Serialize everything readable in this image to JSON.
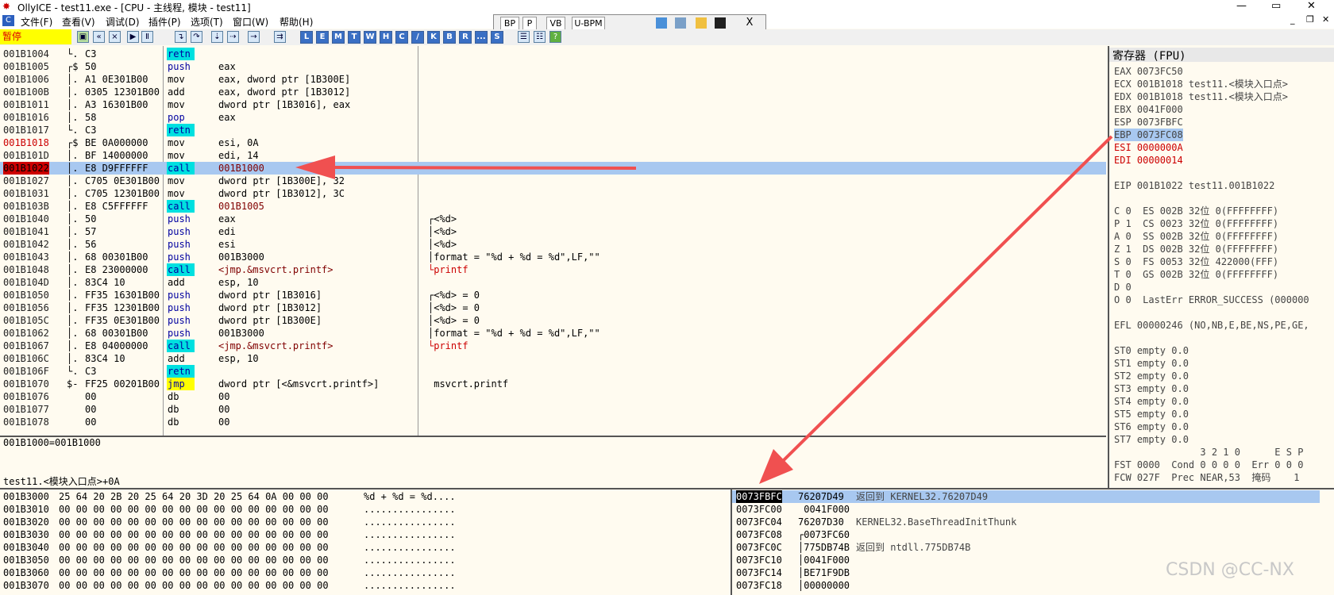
{
  "title_bar": {
    "title": "OllyICE - test11.exe - [CPU - 主线程, 模块 - test11]"
  },
  "menu": [
    "文件(F)",
    "查看(V)",
    "调试(D)",
    "插件(P)",
    "选项(T)",
    "窗口(W)",
    "帮助(H)"
  ],
  "float_toolbar": {
    "buttons": [
      "BP",
      "P",
      "VB",
      "U-BPM"
    ],
    "close": "X"
  },
  "toolbar": {
    "status": "暂停",
    "letter_buttons": [
      "L",
      "E",
      "M",
      "T",
      "W",
      "H",
      "C",
      "/",
      "K",
      "B",
      "R",
      "...",
      "S"
    ]
  },
  "disassembly": {
    "rows": [
      {
        "addr": "001B1004",
        "marker": "└.",
        "hex": "C3",
        "mnem": "retn",
        "operand": "",
        "style": "retn"
      },
      {
        "addr": "001B1005",
        "marker": "┌$",
        "hex": "50",
        "mnem": "push",
        "operand": "eax",
        "style": "blue"
      },
      {
        "addr": "001B1006",
        "marker": "│.",
        "hex": "A1 0E301B00",
        "mnem": "mov",
        "operand": "eax, dword ptr [1B300E]",
        "style": "plain"
      },
      {
        "addr": "001B100B",
        "marker": "│.",
        "hex": "0305 12301B00",
        "mnem": "add",
        "operand": "eax, dword ptr [1B3012]",
        "style": "plain"
      },
      {
        "addr": "001B1011",
        "marker": "│.",
        "hex": "A3 16301B00",
        "mnem": "mov",
        "operand": "dword ptr [1B3016], eax",
        "style": "plain"
      },
      {
        "addr": "001B1016",
        "marker": "│.",
        "hex": "58",
        "mnem": "pop",
        "operand": "eax",
        "style": "blue"
      },
      {
        "addr": "001B1017",
        "marker": "└.",
        "hex": "C3",
        "mnem": "retn",
        "operand": "",
        "style": "retn"
      },
      {
        "addr": "001B1018",
        "marker": "┌$",
        "hex": "BE 0A000000",
        "mnem": "mov",
        "operand": "esi, 0A",
        "style": "plain"
      },
      {
        "addr": "001B101D",
        "marker": "│.",
        "hex": "BF 14000000",
        "mnem": "mov",
        "operand": "edi, 14",
        "style": "plain"
      },
      {
        "addr": "001B1022",
        "marker": "│.",
        "hex": "E8 D9FFFFFF",
        "mnem": "call",
        "operand": "001B1000",
        "style": "call"
      },
      {
        "addr": "001B1027",
        "marker": "│.",
        "hex": "C705 0E301B00",
        "mnem": "mov",
        "operand": "dword ptr [1B300E], 32",
        "style": "plain"
      },
      {
        "addr": "001B1031",
        "marker": "│.",
        "hex": "C705 12301B00",
        "mnem": "mov",
        "operand": "dword ptr [1B3012], 3C",
        "style": "plain"
      },
      {
        "addr": "001B103B",
        "marker": "│.",
        "hex": "E8 C5FFFFFF",
        "mnem": "call",
        "operand": "001B1005",
        "style": "call"
      },
      {
        "addr": "001B1040",
        "marker": "│.",
        "hex": "50",
        "mnem": "push",
        "operand": "eax",
        "style": "blue"
      },
      {
        "addr": "001B1041",
        "marker": "│.",
        "hex": "57",
        "mnem": "push",
        "operand": "edi",
        "style": "blue"
      },
      {
        "addr": "001B1042",
        "marker": "│.",
        "hex": "56",
        "mnem": "push",
        "operand": "esi",
        "style": "blue"
      },
      {
        "addr": "001B1043",
        "marker": "│.",
        "hex": "68 00301B00",
        "mnem": "push",
        "operand": "001B3000",
        "style": "blue"
      },
      {
        "addr": "001B1048",
        "marker": "│.",
        "hex": "E8 23000000",
        "mnem": "call",
        "operand": "<jmp.&msvcrt.printf>",
        "style": "call"
      },
      {
        "addr": "001B104D",
        "marker": "│.",
        "hex": "83C4 10",
        "mnem": "add",
        "operand": "esp, 10",
        "style": "plain"
      },
      {
        "addr": "001B1050",
        "marker": "│.",
        "hex": "FF35 16301B00",
        "mnem": "push",
        "operand": "dword ptr [1B3016]",
        "style": "blue"
      },
      {
        "addr": "001B1056",
        "marker": "│.",
        "hex": "FF35 12301B00",
        "mnem": "push",
        "operand": "dword ptr [1B3012]",
        "style": "blue"
      },
      {
        "addr": "001B105C",
        "marker": "│.",
        "hex": "FF35 0E301B00",
        "mnem": "push",
        "operand": "dword ptr [1B300E]",
        "style": "blue"
      },
      {
        "addr": "001B1062",
        "marker": "│.",
        "hex": "68 00301B00",
        "mnem": "push",
        "operand": "001B3000",
        "style": "blue"
      },
      {
        "addr": "001B1067",
        "marker": "│.",
        "hex": "E8 04000000",
        "mnem": "call",
        "operand": "<jmp.&msvcrt.printf>",
        "style": "call"
      },
      {
        "addr": "001B106C",
        "marker": "│.",
        "hex": "83C4 10",
        "mnem": "add",
        "operand": "esp, 10",
        "style": "plain"
      },
      {
        "addr": "001B106F",
        "marker": "└.",
        "hex": "C3",
        "mnem": "retn",
        "operand": "",
        "style": "retn"
      },
      {
        "addr": "001B1070",
        "marker": "$-",
        "hex": "FF25 00201B00",
        "mnem": "jmp",
        "operand": "dword ptr [<&msvcrt.printf>]",
        "style": "jmp"
      },
      {
        "addr": "001B1076",
        "marker": "",
        "hex": "00",
        "mnem": "db",
        "operand": "00",
        "style": "plain"
      },
      {
        "addr": "001B1077",
        "marker": "",
        "hex": "00",
        "mnem": "db",
        "operand": "00",
        "style": "plain"
      },
      {
        "addr": "001B1078",
        "marker": "",
        "hex": "00",
        "mnem": "db",
        "operand": "00",
        "style": "plain"
      }
    ],
    "comments": [
      {
        "row": 13,
        "text": "┌<%d>"
      },
      {
        "row": 14,
        "text": "│<%d>"
      },
      {
        "row": 15,
        "text": "│<%d>"
      },
      {
        "row": 16,
        "text": "│format = \"%d + %d = %d\",LF,\"\""
      },
      {
        "row": 17,
        "text": "└printf"
      },
      {
        "row": 19,
        "text": "┌<%d> = 0"
      },
      {
        "row": 20,
        "text": "│<%d> = 0"
      },
      {
        "row": 21,
        "text": "│<%d> = 0"
      },
      {
        "row": 22,
        "text": "│format = \"%d + %d = %d\",LF,\"\""
      },
      {
        "row": 23,
        "text": "└printf"
      },
      {
        "row": 26,
        "text": " msvcrt.printf"
      }
    ]
  },
  "info": {
    "line1": "001B1000=001B1000",
    "line2": "test11.<模块入口点>+0A"
  },
  "registers": {
    "title": "寄存器 (FPU)",
    "rows": [
      {
        "text": "EAX 0073FC50",
        "style": "plain"
      },
      {
        "text": "ECX 001B1018 test11.<模块入口点>",
        "style": "plain"
      },
      {
        "text": "EDX 001B1018 test11.<模块入口点>",
        "style": "plain"
      },
      {
        "text": "EBX 0041F000",
        "style": "plain"
      },
      {
        "text": "ESP 0073FBFC",
        "style": "plain"
      },
      {
        "text": "EBP 0073FC08",
        "style": "hl"
      },
      {
        "text": "ESI 0000000A",
        "style": "chg"
      },
      {
        "text": "EDI 00000014",
        "style": "chg"
      },
      {
        "text": "",
        "style": "plain"
      },
      {
        "text": "EIP 001B1022 test11.001B1022",
        "style": "eip"
      },
      {
        "text": "",
        "style": "plain"
      },
      {
        "text": "C 0  ES 002B 32位 0(FFFFFFFF)",
        "style": "plain"
      },
      {
        "text": "P 1  CS 0023 32位 0(FFFFFFFF)",
        "style": "plain"
      },
      {
        "text": "A 0  SS 002B 32位 0(FFFFFFFF)",
        "style": "plain"
      },
      {
        "text": "Z 1  DS 002B 32位 0(FFFFFFFF)",
        "style": "plain"
      },
      {
        "text": "S 0  FS 0053 32位 422000(FFF)",
        "style": "plain"
      },
      {
        "text": "T 0  GS 002B 32位 0(FFFFFFFF)",
        "style": "plain"
      },
      {
        "text": "D 0",
        "style": "plain"
      },
      {
        "text": "O 0  LastErr ERROR_SUCCESS (000000",
        "style": "plain"
      },
      {
        "text": "",
        "style": "plain"
      },
      {
        "text": "EFL 00000246 (NO,NB,E,BE,NS,PE,GE,",
        "style": "plain"
      },
      {
        "text": "",
        "style": "plain"
      },
      {
        "text": "ST0 empty 0.0",
        "style": "plain"
      },
      {
        "text": "ST1 empty 0.0",
        "style": "plain"
      },
      {
        "text": "ST2 empty 0.0",
        "style": "plain"
      },
      {
        "text": "ST3 empty 0.0",
        "style": "plain"
      },
      {
        "text": "ST4 empty 0.0",
        "style": "plain"
      },
      {
        "text": "ST5 empty 0.0",
        "style": "plain"
      },
      {
        "text": "ST6 empty 0.0",
        "style": "plain"
      },
      {
        "text": "ST7 empty 0.0",
        "style": "plain"
      },
      {
        "text": "               3 2 1 0      E S P",
        "style": "plain"
      },
      {
        "text": "FST 0000  Cond 0 0 0 0  Err 0 0 0",
        "style": "plain"
      },
      {
        "text": "FCW 027F  Prec NEAR,53  掩码    1",
        "style": "plain"
      }
    ]
  },
  "dump": {
    "rows": [
      {
        "addr": "001B3000",
        "hex": "25 64 20 2B 20 25 64 20 3D 20 25 64 0A 00 00 00",
        "ascii": "%d + %d = %d...."
      },
      {
        "addr": "001B3010",
        "hex": "00 00 00 00 00 00 00 00 00 00 00 00 00 00 00 00",
        "ascii": "................"
      },
      {
        "addr": "001B3020",
        "hex": "00 00 00 00 00 00 00 00 00 00 00 00 00 00 00 00",
        "ascii": "................"
      },
      {
        "addr": "001B3030",
        "hex": "00 00 00 00 00 00 00 00 00 00 00 00 00 00 00 00",
        "ascii": "................"
      },
      {
        "addr": "001B3040",
        "hex": "00 00 00 00 00 00 00 00 00 00 00 00 00 00 00 00",
        "ascii": "................"
      },
      {
        "addr": "001B3050",
        "hex": "00 00 00 00 00 00 00 00 00 00 00 00 00 00 00 00",
        "ascii": "................"
      },
      {
        "addr": "001B3060",
        "hex": "00 00 00 00 00 00 00 00 00 00 00 00 00 00 00 00",
        "ascii": "................"
      },
      {
        "addr": "001B3070",
        "hex": "00 00 00 00 00 00 00 00 00 00 00 00 00 00 00 00",
        "ascii": "................"
      }
    ]
  },
  "stack": {
    "rows": [
      {
        "addr": "0073FBFC",
        "value": "76207D49",
        "comment": "返回到 KERNEL32.76207D49"
      },
      {
        "addr": "0073FC00",
        "value": " 0041F000",
        "comment": ""
      },
      {
        "addr": "0073FC04",
        "value": "76207D30",
        "comment": "KERNEL32.BaseThreadInitThunk"
      },
      {
        "addr": "0073FC08",
        "value": "┌0073FC60",
        "comment": ""
      },
      {
        "addr": "0073FC0C",
        "value": "│775DB74B",
        "comment": "返回到 ntdll.775DB74B"
      },
      {
        "addr": "0073FC10",
        "value": "│0041F000",
        "comment": ""
      },
      {
        "addr": "0073FC14",
        "value": "│BE71F9DB",
        "comment": ""
      },
      {
        "addr": "0073FC18",
        "value": "│00000000",
        "comment": ""
      }
    ]
  },
  "watermark": "CSDN @CC-NX",
  "colors": {
    "selection": "#a8c8f0",
    "call_bg": "#00e0e0",
    "jmp_bg": "#ffff00",
    "arrow": "#f05050",
    "pane_bg": "#fffbf0"
  }
}
